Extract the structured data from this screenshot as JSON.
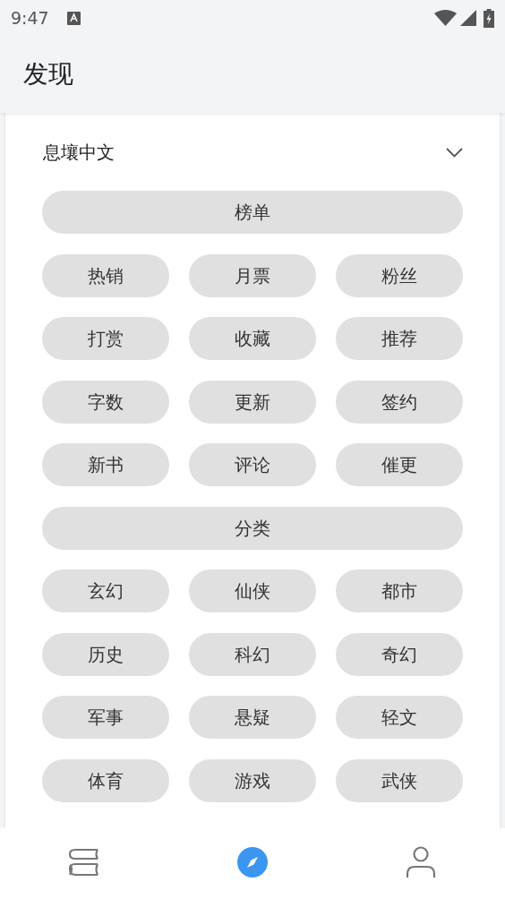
{
  "status_bar": {
    "time": "9:47"
  },
  "header": {
    "title": "发现"
  },
  "source": {
    "label": "息壤中文"
  },
  "chips": [
    {
      "label": "榜单",
      "kind": "heading"
    },
    {
      "label": "热销",
      "kind": "item"
    },
    {
      "label": "月票",
      "kind": "item"
    },
    {
      "label": "粉丝",
      "kind": "item"
    },
    {
      "label": "打赏",
      "kind": "item"
    },
    {
      "label": "收藏",
      "kind": "item"
    },
    {
      "label": "推荐",
      "kind": "item"
    },
    {
      "label": "字数",
      "kind": "item"
    },
    {
      "label": "更新",
      "kind": "item"
    },
    {
      "label": "签约",
      "kind": "item"
    },
    {
      "label": "新书",
      "kind": "item"
    },
    {
      "label": "评论",
      "kind": "item"
    },
    {
      "label": "催更",
      "kind": "item"
    },
    {
      "label": "分类",
      "kind": "heading"
    },
    {
      "label": "玄幻",
      "kind": "item"
    },
    {
      "label": "仙侠",
      "kind": "item"
    },
    {
      "label": "都市",
      "kind": "item"
    },
    {
      "label": "历史",
      "kind": "item"
    },
    {
      "label": "科幻",
      "kind": "item"
    },
    {
      "label": "奇幻",
      "kind": "item"
    },
    {
      "label": "军事",
      "kind": "item"
    },
    {
      "label": "悬疑",
      "kind": "item"
    },
    {
      "label": "轻文",
      "kind": "item"
    },
    {
      "label": "体育",
      "kind": "item"
    },
    {
      "label": "游戏",
      "kind": "item"
    },
    {
      "label": "武侠",
      "kind": "item"
    }
  ],
  "bottom_nav": [
    {
      "kind": "books",
      "selected": false
    },
    {
      "kind": "compass",
      "selected": true
    },
    {
      "kind": "person",
      "selected": false
    }
  ]
}
